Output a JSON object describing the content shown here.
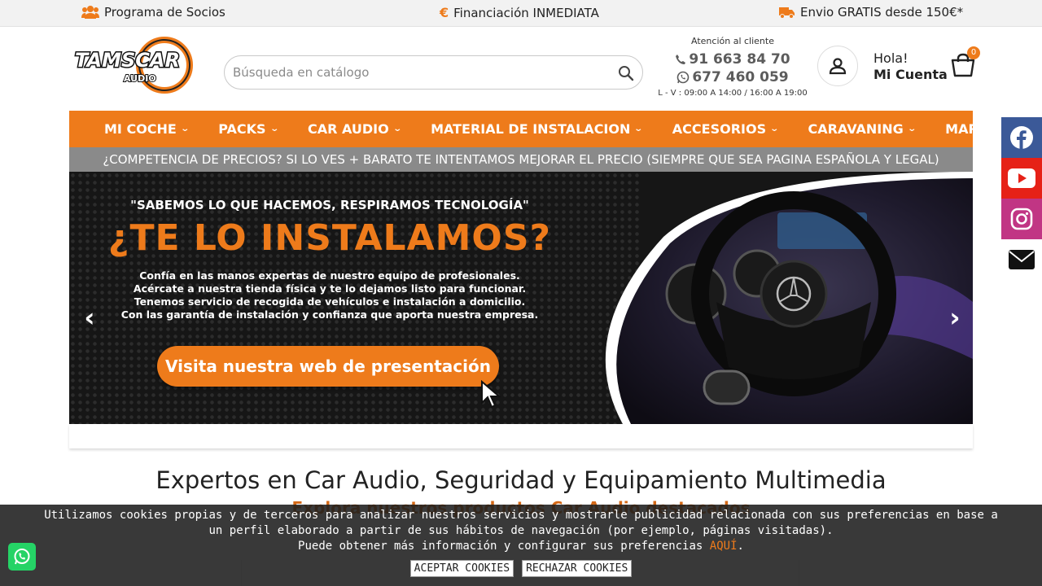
{
  "topbar": {
    "partners": "Programa de Socios",
    "financing": "Financiación INMEDIATA",
    "shipping": "Envio GRATIS desde 150€*"
  },
  "logo": {
    "text": "TAMSCAR",
    "sub": "AUDIO"
  },
  "search": {
    "placeholder": "Búsqueda en catálogo"
  },
  "support": {
    "label": "Atención al cliente",
    "phone": "91 663 84 70",
    "whatsapp": "677 460 059",
    "hours": "L - V : 09:00 A 14:00 / 16:00 A 19:00"
  },
  "account": {
    "greeting": "Hola!",
    "label": "Mi Cuenta"
  },
  "cart": {
    "count": "0"
  },
  "nav": {
    "items": [
      {
        "label": "MI COCHE"
      },
      {
        "label": "PACKS"
      },
      {
        "label": "CAR AUDIO"
      },
      {
        "label": "MATERIAL DE INSTALACION"
      },
      {
        "label": "ACCESORIOS"
      },
      {
        "label": "CARAVANING"
      },
      {
        "label": "MARCAS"
      }
    ]
  },
  "promo": "¿COMPETENCIA DE PRECIOS? SI LO VES + BARATO TE INTENTAMOS MEJORAR EL PRECIO (SIEMPRE QUE SEA PAGINA ESPAÑOLA Y LEGAL)",
  "slider": {
    "quote": "\"SABEMOS LO QUE HACEMOS, RESPIRAMOS TECNOLOGÍA\"",
    "title": "¿TE LO INSTALAMOS?",
    "body": [
      "Confía en las manos expertas de nuestro equipo de profesionales.",
      "Acércate a nuestra tienda física y te lo dejamos listo para funcionar.",
      "Tenemos servicio de recogida de vehículos e instalación a domicilio.",
      "Con las garantía de instalación y confianza que aporta nuestra empresa."
    ],
    "cta": "Visita nuestra web de presentación"
  },
  "main": {
    "title": "Expertos en Car Audio, Seguridad y Equipamiento Multimedia",
    "subtitle": "Explora nuestros productos Car Audio destacados"
  },
  "social": [
    {
      "icon": "facebook-icon",
      "color": "#3b5998"
    },
    {
      "icon": "youtube-icon",
      "color": "#e62117"
    },
    {
      "icon": "instagram-icon",
      "color": "#c13584"
    },
    {
      "icon": "mail-icon",
      "color": "#ffffff"
    }
  ],
  "cookie": {
    "line1": "Utilizamos cookies propias y de terceros para analizar nuestros servicios y mostrarle publicidad relacionada con sus preferencias en base a",
    "line2": "un perfil elaborado a partir de sus hábitos de navegación (por ejemplo, páginas visitadas).",
    "line3": "Puede obtener más información y configurar sus preferencias",
    "link": "AQUÍ",
    "accept": "ACEPTAR COOKIES",
    "reject": "RECHAZAR COOKIES"
  },
  "colors": {
    "accent": "#ee7b1b",
    "promo_bg": "#8a8a8a",
    "whatsapp": "#25d366"
  }
}
